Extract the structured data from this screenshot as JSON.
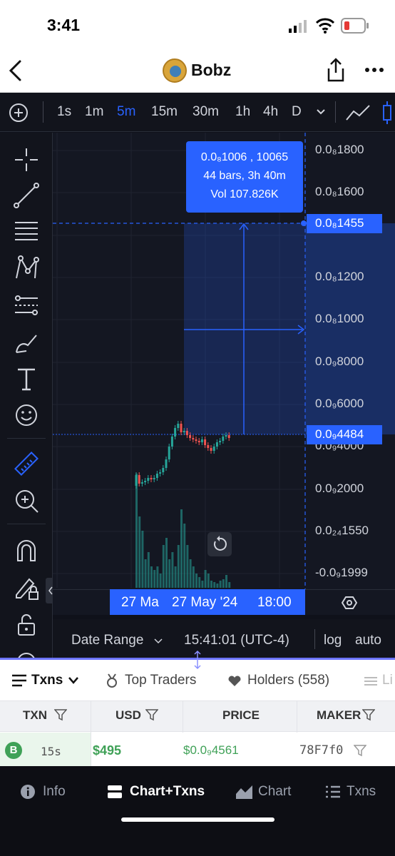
{
  "status": {
    "time": "3:41"
  },
  "header": {
    "title": "Bobz"
  },
  "timeframes": [
    "1s",
    "1m",
    "5m",
    "15m",
    "30m",
    "1h",
    "4h",
    "D"
  ],
  "active_timeframe": "5m",
  "tooltip": {
    "line1": "0.0₈1006 , 10065",
    "line2": "44 bars, 3h 40m",
    "line3": "Vol 107.826K"
  },
  "price_axis": [
    "0.0₈1800",
    "0.0₈1600",
    "0.0₈1200",
    "0.0₈1000",
    "0.0₉8000",
    "0.0₉6000",
    "0.0₉4000",
    "0.0₉2000",
    "0.0₂₄1550",
    "-0.0₉1999"
  ],
  "price_highlight_top": "0.0₈1455",
  "price_highlight_bottom": "0.0₉4484",
  "time_axis": {
    "left": "27 Ma",
    "center": "27 May '24",
    "right": "18:00"
  },
  "controls": {
    "date_range": "Date Range",
    "clock": "15:41:01 (UTC-4)",
    "log": "log",
    "auto": "auto"
  },
  "tabs": {
    "txns": "Txns",
    "top_traders": "Top Traders",
    "holders": "Holders (558)",
    "liquidity": "Li"
  },
  "columns": [
    "TXN",
    "USD",
    "PRICE",
    "MAKER"
  ],
  "row": {
    "badge": "B",
    "age": "15s",
    "usd": "$495",
    "price": "$0.0₉4561",
    "maker": "78F7f0"
  },
  "bottom_nav": {
    "info": "Info",
    "chart_txns": "Chart+Txns",
    "chart": "Chart",
    "txns": "Txns"
  },
  "colors": {
    "accent": "#2962ff",
    "up": "#26a69a",
    "down": "#ef5350",
    "buy": "#3fa157"
  }
}
